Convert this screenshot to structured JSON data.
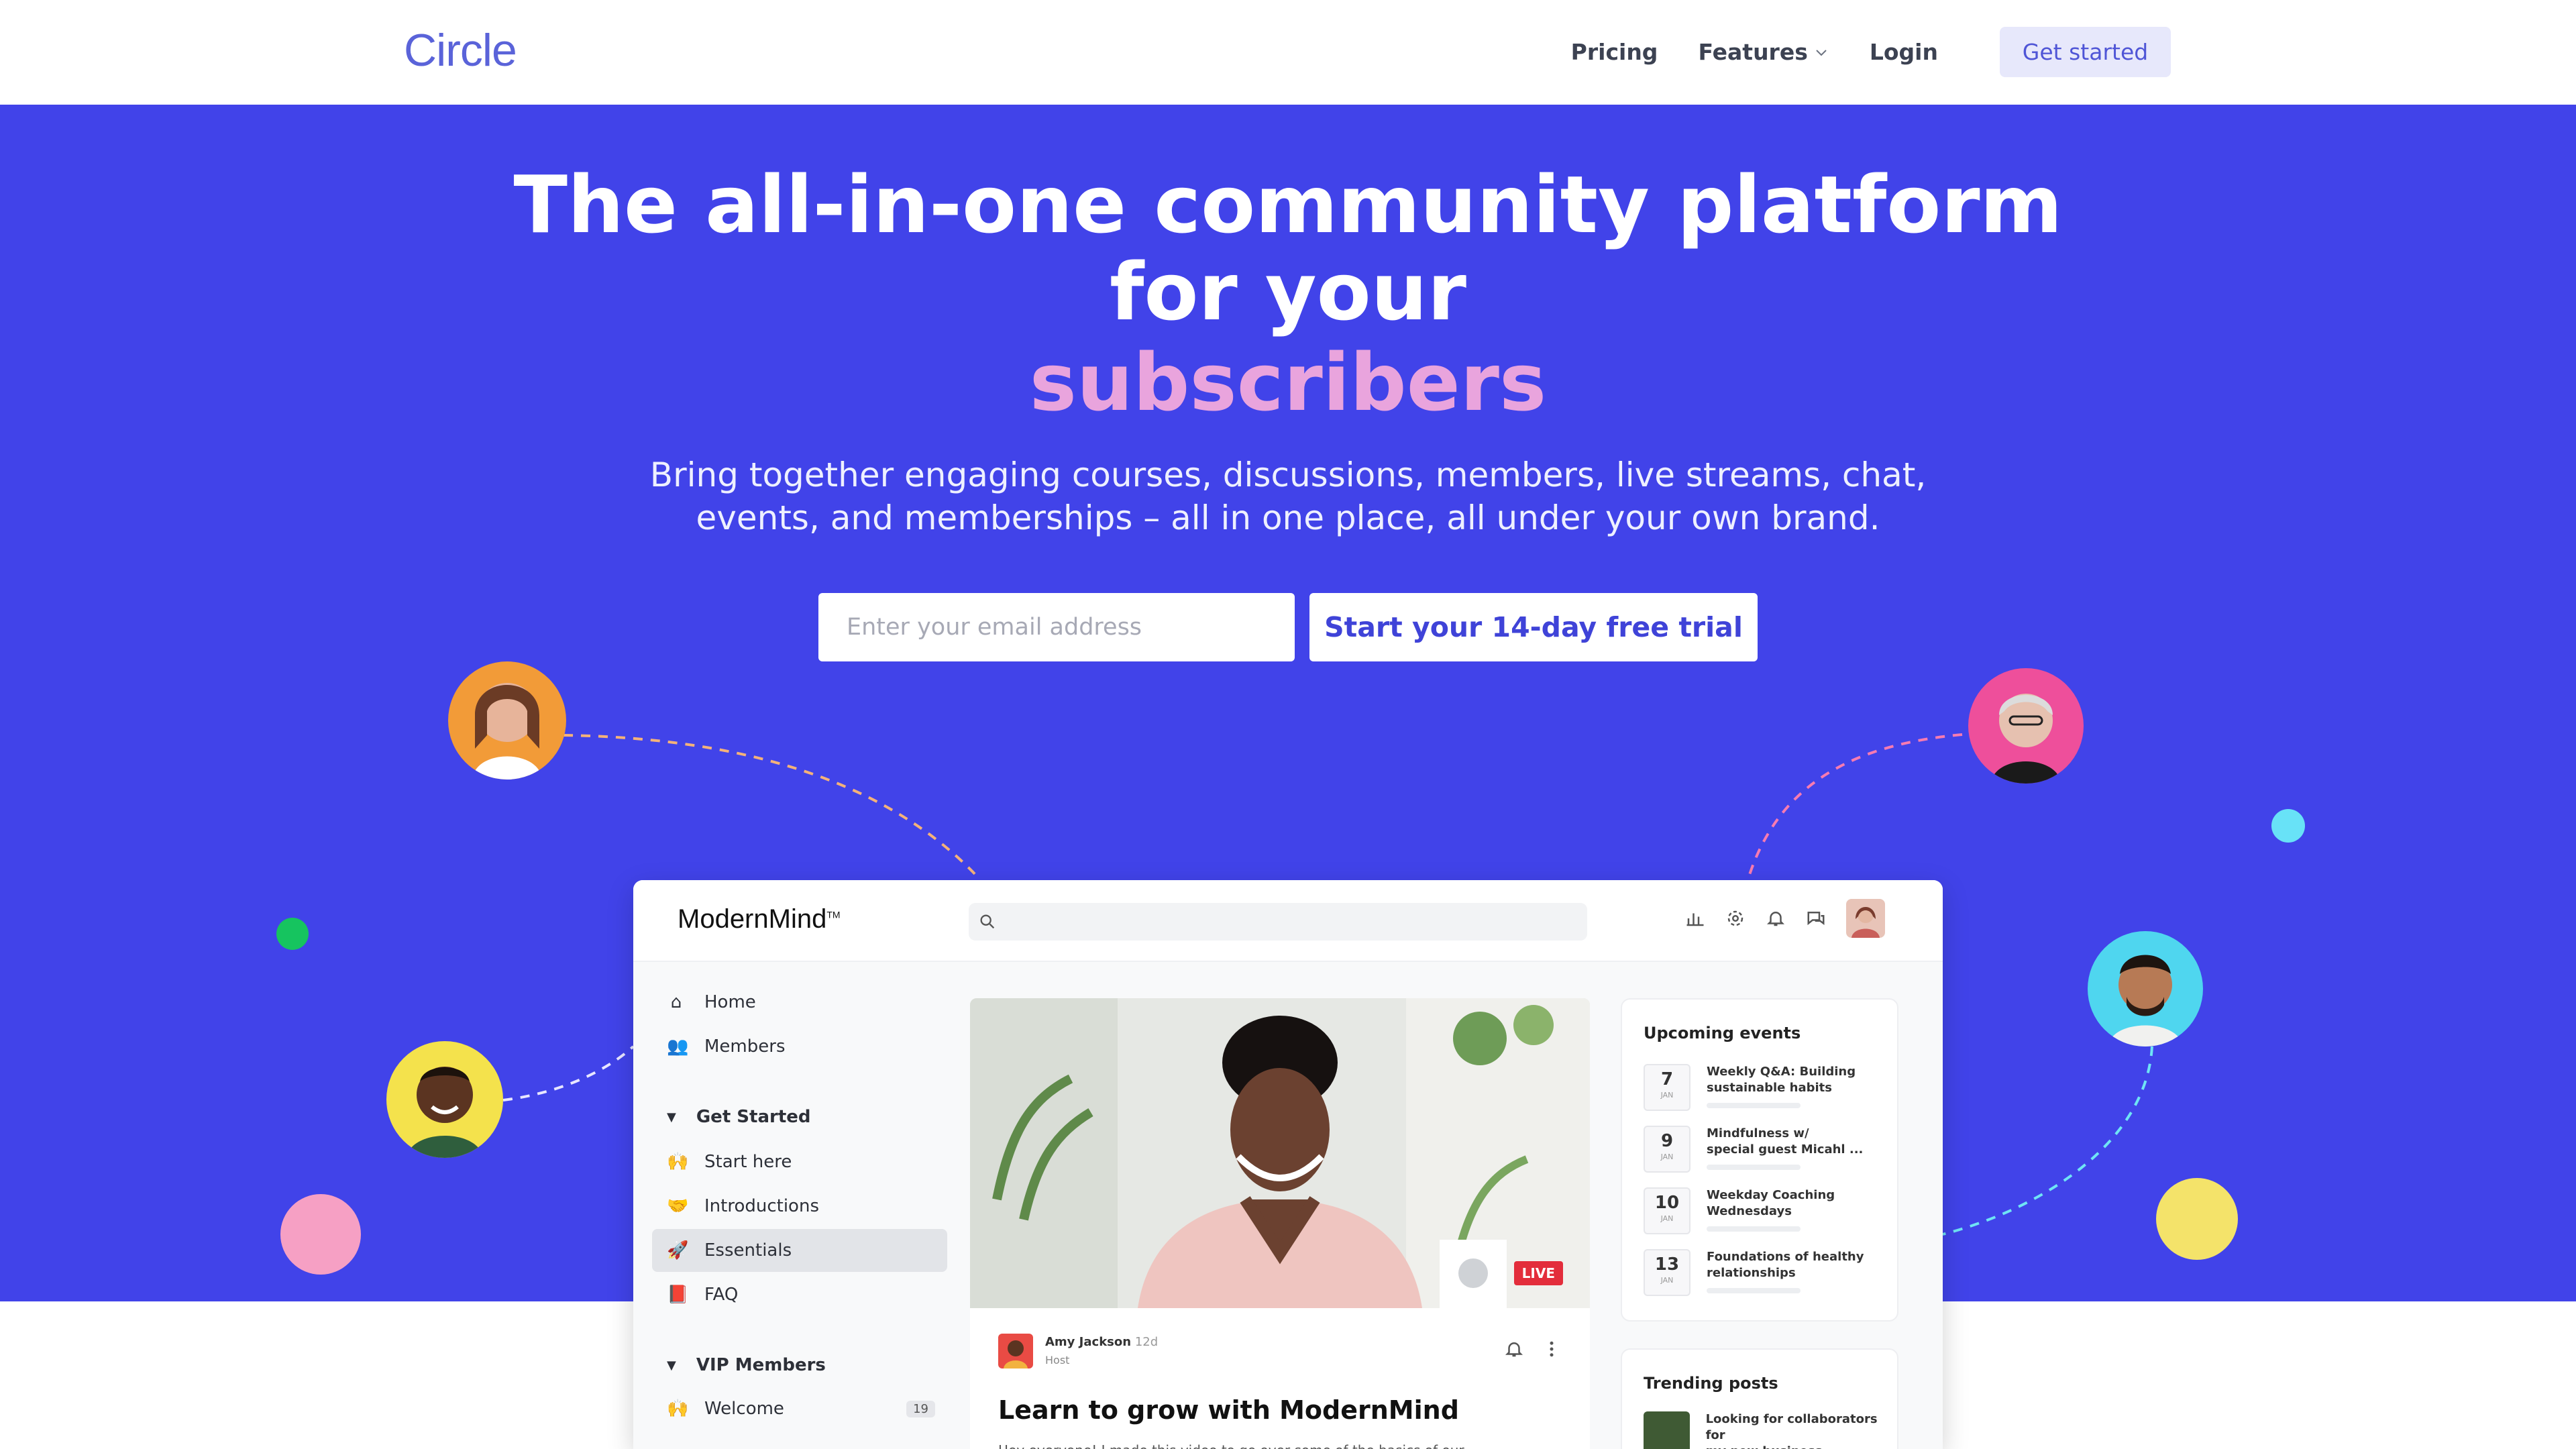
{
  "brand": {
    "logo": "Circle"
  },
  "nav": {
    "pricing": "Pricing",
    "features": "Features",
    "login": "Login",
    "cta": "Get started"
  },
  "hero": {
    "title": "The all-in-one community platform for your",
    "accent": "subscribers",
    "subtitle_line1": "Bring together engaging courses, discussions, members, live streams, chat,",
    "subtitle_line2": "events, and memberships – all in one place, all under your own brand.",
    "email_placeholder": "Enter your email address",
    "trial_button": "Start your 14-day free trial"
  },
  "app": {
    "brand": "ModernMind",
    "brand_tm": "TM",
    "sidebar": {
      "items_top": [
        {
          "label": "Home",
          "icon": "home-icon"
        },
        {
          "label": "Members",
          "icon": "members-icon"
        }
      ],
      "group1": "Get Started",
      "group1_items": [
        {
          "label": "Start here",
          "icon": "🙌"
        },
        {
          "label": "Introductions",
          "icon": "🤝"
        },
        {
          "label": "Essentials",
          "icon": "🚀"
        },
        {
          "label": "FAQ",
          "icon": "📕"
        }
      ],
      "group2": "VIP Members",
      "group2_items": [
        {
          "label": "Welcome",
          "icon": "🙌",
          "badge": "19"
        }
      ]
    },
    "video": {
      "live": "LIVE"
    },
    "post": {
      "author": "Amy Jackson",
      "time": "12d",
      "role": "Host",
      "title": "Learn to grow with ModernMind",
      "excerpt": "Hey everyone! I made this video to go over some of the basics of our"
    },
    "events": {
      "title": "Upcoming events",
      "items": [
        {
          "day": "7",
          "month": "JAN",
          "line1": "Weekly Q&A: Building",
          "line2": "sustainable habits"
        },
        {
          "day": "9",
          "month": "JAN",
          "line1": "Mindfulness w/",
          "line2": "special guest Micahl ..."
        },
        {
          "day": "10",
          "month": "JAN",
          "line1": "Weekday Coaching",
          "line2": "Wednesdays"
        },
        {
          "day": "13",
          "month": "JAN",
          "line1": "Foundations of healthy",
          "line2": "relationships"
        }
      ]
    },
    "trending": {
      "title": "Trending posts",
      "line1": "Looking for collaborators for",
      "line2": "my new business.."
    }
  },
  "colors": {
    "hero_bg": "#4143e9",
    "accent": "#e9a4dd",
    "logo": "#5a63d9"
  }
}
